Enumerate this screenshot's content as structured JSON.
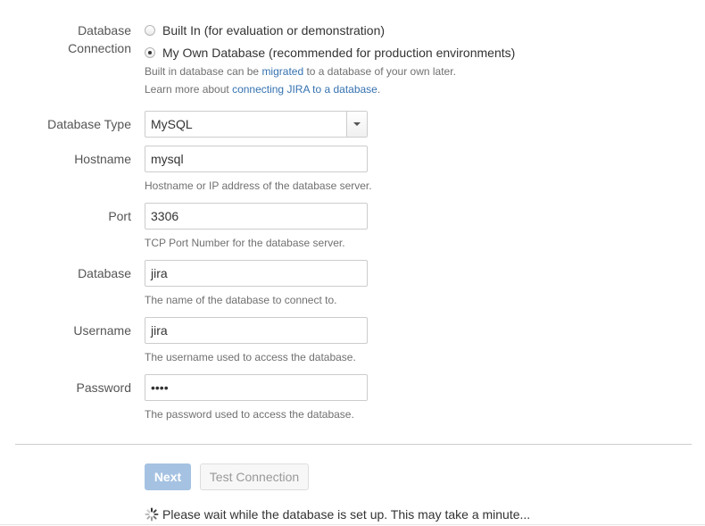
{
  "connection": {
    "label_line1": "Database",
    "label_line2": "Connection",
    "option_builtin": "Built In (for evaluation or demonstration)",
    "option_own": "My Own Database (recommended for production environments)",
    "selected": "own",
    "help_line1_prefix": "Built in database can be ",
    "help_line1_link": "migrated",
    "help_line1_suffix": " to a database of your own later.",
    "help_line2_prefix": "Learn more about ",
    "help_line2_link": "connecting JIRA to a database",
    "help_line2_suffix": "."
  },
  "fields": {
    "database_type": {
      "label": "Database Type",
      "value": "MySQL"
    },
    "hostname": {
      "label": "Hostname",
      "value": "mysql",
      "help": "Hostname or IP address of the database server."
    },
    "port": {
      "label": "Port",
      "value": "3306",
      "help": "TCP Port Number for the database server."
    },
    "database": {
      "label": "Database",
      "value": "jira",
      "help": "The name of the database to connect to."
    },
    "username": {
      "label": "Username",
      "value": "jira",
      "help": "The username used to access the database."
    },
    "password": {
      "label": "Password",
      "value": "••••",
      "help": "The password used to access the database."
    }
  },
  "buttons": {
    "next": "Next",
    "test_connection": "Test Connection"
  },
  "status": {
    "wait_message": "Please wait while the database is set up. This may take a minute...",
    "spinner_icon": "loading-spinner-icon"
  },
  "colors": {
    "link": "#3572b0",
    "primary_button_disabled": "#a5c2e2"
  }
}
